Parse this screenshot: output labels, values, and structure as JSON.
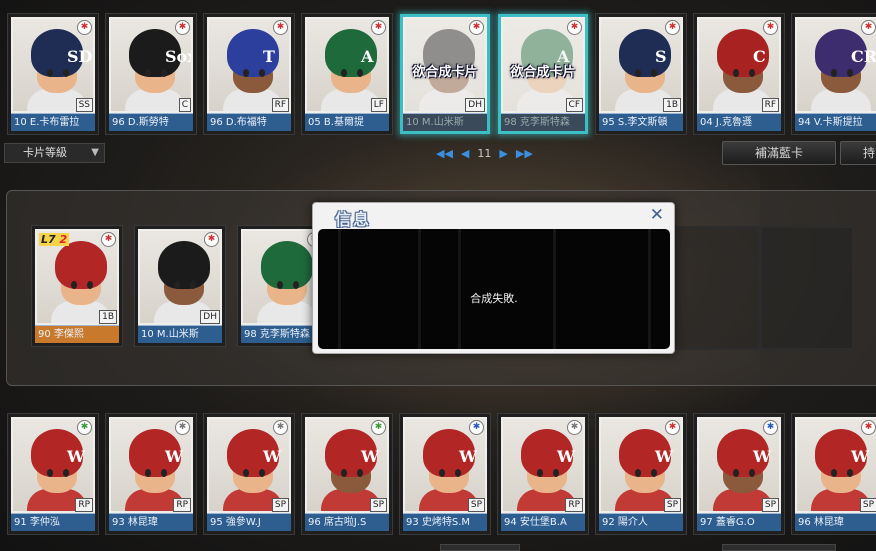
{
  "top_cards": [
    {
      "name": "10 E.卡布雷拉",
      "pos": "SS",
      "logo": "SD",
      "helmet": "#1f2d55",
      "glow": false,
      "dim": false,
      "skin": "light"
    },
    {
      "name": "96 D.斯勞特",
      "pos": "C",
      "logo": "Sox",
      "helmet": "#1b1b1b",
      "glow": false,
      "dim": false,
      "skin": "light"
    },
    {
      "name": "96 D.布福特",
      "pos": "RF",
      "logo": "T",
      "helmet": "#2d3f9c",
      "glow": false,
      "dim": false,
      "skin": "dark"
    },
    {
      "name": "05 B.基爾提",
      "pos": "LF",
      "logo": "A",
      "helmet": "#1f6a3a",
      "glow": false,
      "dim": false,
      "skin": "light"
    },
    {
      "name": "10 M.山米斯",
      "pos": "DH",
      "logo": "",
      "helmet": "#1b1b1b",
      "glow": true,
      "dim": true,
      "skin": "dark",
      "overlay": "欲合成卡片"
    },
    {
      "name": "98 克李斯特森",
      "pos": "CF",
      "logo": "A",
      "helmet": "#1f6a3a",
      "glow": true,
      "dim": true,
      "skin": "light",
      "overlay": "欲合成卡片"
    },
    {
      "name": "95 S.李文斯頓",
      "pos": "1B",
      "logo": "S",
      "helmet": "#1f2d55",
      "glow": false,
      "dim": false,
      "skin": "light"
    },
    {
      "name": "04 J.克魯遜",
      "pos": "RF",
      "logo": "C",
      "helmet": "#a92222",
      "glow": false,
      "dim": false,
      "skin": "dark"
    },
    {
      "name": "94 V.卡斯提拉",
      "pos": "",
      "logo": "CR",
      "helmet": "#3d2c6e",
      "glow": false,
      "dim": false,
      "skin": "dark"
    }
  ],
  "controls": {
    "grade_select": "卡片等級",
    "page_number": "11",
    "fill_button": "補滿藍卡",
    "hold_button": "持"
  },
  "middle_cards": [
    {
      "name": "90 李傑熙",
      "pos": "1B",
      "level": "L7",
      "level_num": "2",
      "style": "orange",
      "helmet": "#b32626",
      "skin": "light"
    },
    {
      "name": "10 M.山米斯",
      "pos": "DH",
      "style": "blue",
      "helmet": "#1b1b1b",
      "skin": "dark"
    },
    {
      "name": "98 克李斯特森",
      "pos": "",
      "style": "blue",
      "helmet": "#1f6a3a",
      "skin": "light"
    }
  ],
  "modal": {
    "title": "信息",
    "close_icon": "close-icon",
    "message": "合成失敗."
  },
  "bottom_cards": [
    {
      "name": "91 李仲泓",
      "pos": "RP",
      "badge": "green"
    },
    {
      "name": "93 林昆瑋",
      "pos": "RP",
      "badge": "gray"
    },
    {
      "name": "95 強參W.J",
      "pos": "SP",
      "badge": "gray"
    },
    {
      "name": "96 席古啦J.S",
      "pos": "SP",
      "badge": "green"
    },
    {
      "name": "93 史烤特S.M",
      "pos": "SP",
      "badge": "blue"
    },
    {
      "name": "94 安仕堡B.A",
      "pos": "RP",
      "badge": "gray"
    },
    {
      "name": "92 陽介人",
      "pos": "SP",
      "badge": "red"
    },
    {
      "name": "97 蓋睿G.O",
      "pos": "SP",
      "badge": "blue"
    },
    {
      "name": "96 林昆瑋",
      "pos": "SP",
      "badge": "red"
    }
  ],
  "colors": {
    "card_footer_blue": "#2e5d8f",
    "glow_cyan": "#3bbfc4",
    "pager_blue": "#3c8ede",
    "modal_title_outline": "#45628b"
  }
}
